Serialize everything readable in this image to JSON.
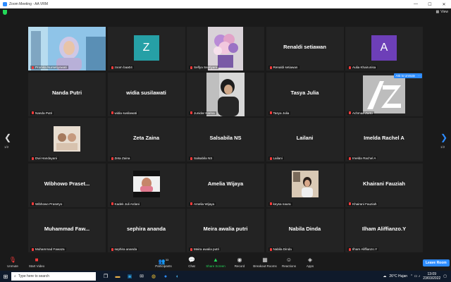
{
  "window": {
    "title": "Zoom Meeting - AA VRM"
  },
  "topbar": {
    "view_label": "View"
  },
  "grid": {
    "page_indicator_left": "1/2",
    "page_indicator_right": "1/2",
    "tiles": [
      {
        "label": "Promita Nursetiyowati",
        "big_name": "",
        "type": "video-woman"
      },
      {
        "label": "zoom baa04",
        "big_name": "",
        "type": "letter",
        "letter": "Z",
        "color": "#26a0a6"
      },
      {
        "label": "Selfya Septiyani",
        "big_name": "",
        "type": "flowers"
      },
      {
        "label": "Renaldi setiawan",
        "big_name": "Renaldi setiawan",
        "type": "name"
      },
      {
        "label": "Aulia Khairunisa",
        "big_name": "",
        "type": "letter",
        "letter": "A",
        "color": "#6d3fb8"
      },
      {
        "label": "Nanda Putri",
        "big_name": "Nanda Putri",
        "type": "name"
      },
      {
        "label": "widia susilawati",
        "big_name": "widia susilawati",
        "type": "name"
      },
      {
        "label": "Junidar Karina",
        "big_name": "",
        "type": "person-dark"
      },
      {
        "label": "Tasya Julia",
        "big_name": "Tasya Julia",
        "type": "name"
      },
      {
        "label": "Achmad Zarto",
        "big_name": "",
        "type": "logo",
        "ask_unmute": "Ask to Unmute",
        "more": "···"
      },
      {
        "label": "Dwi Handayani",
        "big_name": "",
        "type": "small-photo"
      },
      {
        "label": "Zeta Zaina",
        "big_name": "Zeta Zaina",
        "type": "name"
      },
      {
        "label": "Salsabila NS",
        "big_name": "Salsabila NS",
        "type": "name"
      },
      {
        "label": "Lailani",
        "big_name": "Lailani",
        "type": "name"
      },
      {
        "label": "Imelda Rachel A",
        "big_name": "Imelda Rachel A",
        "type": "name"
      },
      {
        "label": "Wibhowo Prasetyo",
        "big_name": "Wibhowo Praset...",
        "type": "name"
      },
      {
        "label": "Kadek Juli Ardani",
        "big_name": "",
        "type": "video-kadek"
      },
      {
        "label": "Amelia Wijaya",
        "big_name": "Amelia Wijaya",
        "type": "name"
      },
      {
        "label": "keysa naura",
        "big_name": "",
        "type": "photo-keysa"
      },
      {
        "label": "Khairani Fauziah",
        "big_name": "Khairani Fauziah",
        "type": "name"
      },
      {
        "label": "Muhammad Fawaza",
        "big_name": "Muhammad  Faw...",
        "type": "name"
      },
      {
        "label": "sephira ananda",
        "big_name": "sephira ananda",
        "type": "name"
      },
      {
        "label": "Meira awalia putri",
        "big_name": "Meira awalia putri",
        "type": "name"
      },
      {
        "label": "Nabila Dinda",
        "big_name": "Nabila Dinda",
        "type": "name"
      },
      {
        "label": "Ilham Aliffianzo.Y",
        "big_name": "Ilham Aliffianzo.Y",
        "type": "name"
      }
    ]
  },
  "toolbar": {
    "unmute": "Unmute",
    "start_video": "Start Video",
    "participants": "Participants",
    "participants_count": "33",
    "chat": "Chat",
    "share_screen": "Share Screen",
    "record": "Record",
    "breakout_rooms": "Breakout Rooms",
    "reactions": "Reactions",
    "apps": "Apps",
    "leave": "Leave Room"
  },
  "taskbar": {
    "search_placeholder": "Type here to search",
    "weather": "26°C  Hujan",
    "time": "13:09",
    "date": "23/03/2022"
  },
  "colors": {
    "accent": "#2d8cff",
    "active_speaker": "#e2d43a",
    "muted": "#ff3b3b",
    "share": "#23d959"
  }
}
